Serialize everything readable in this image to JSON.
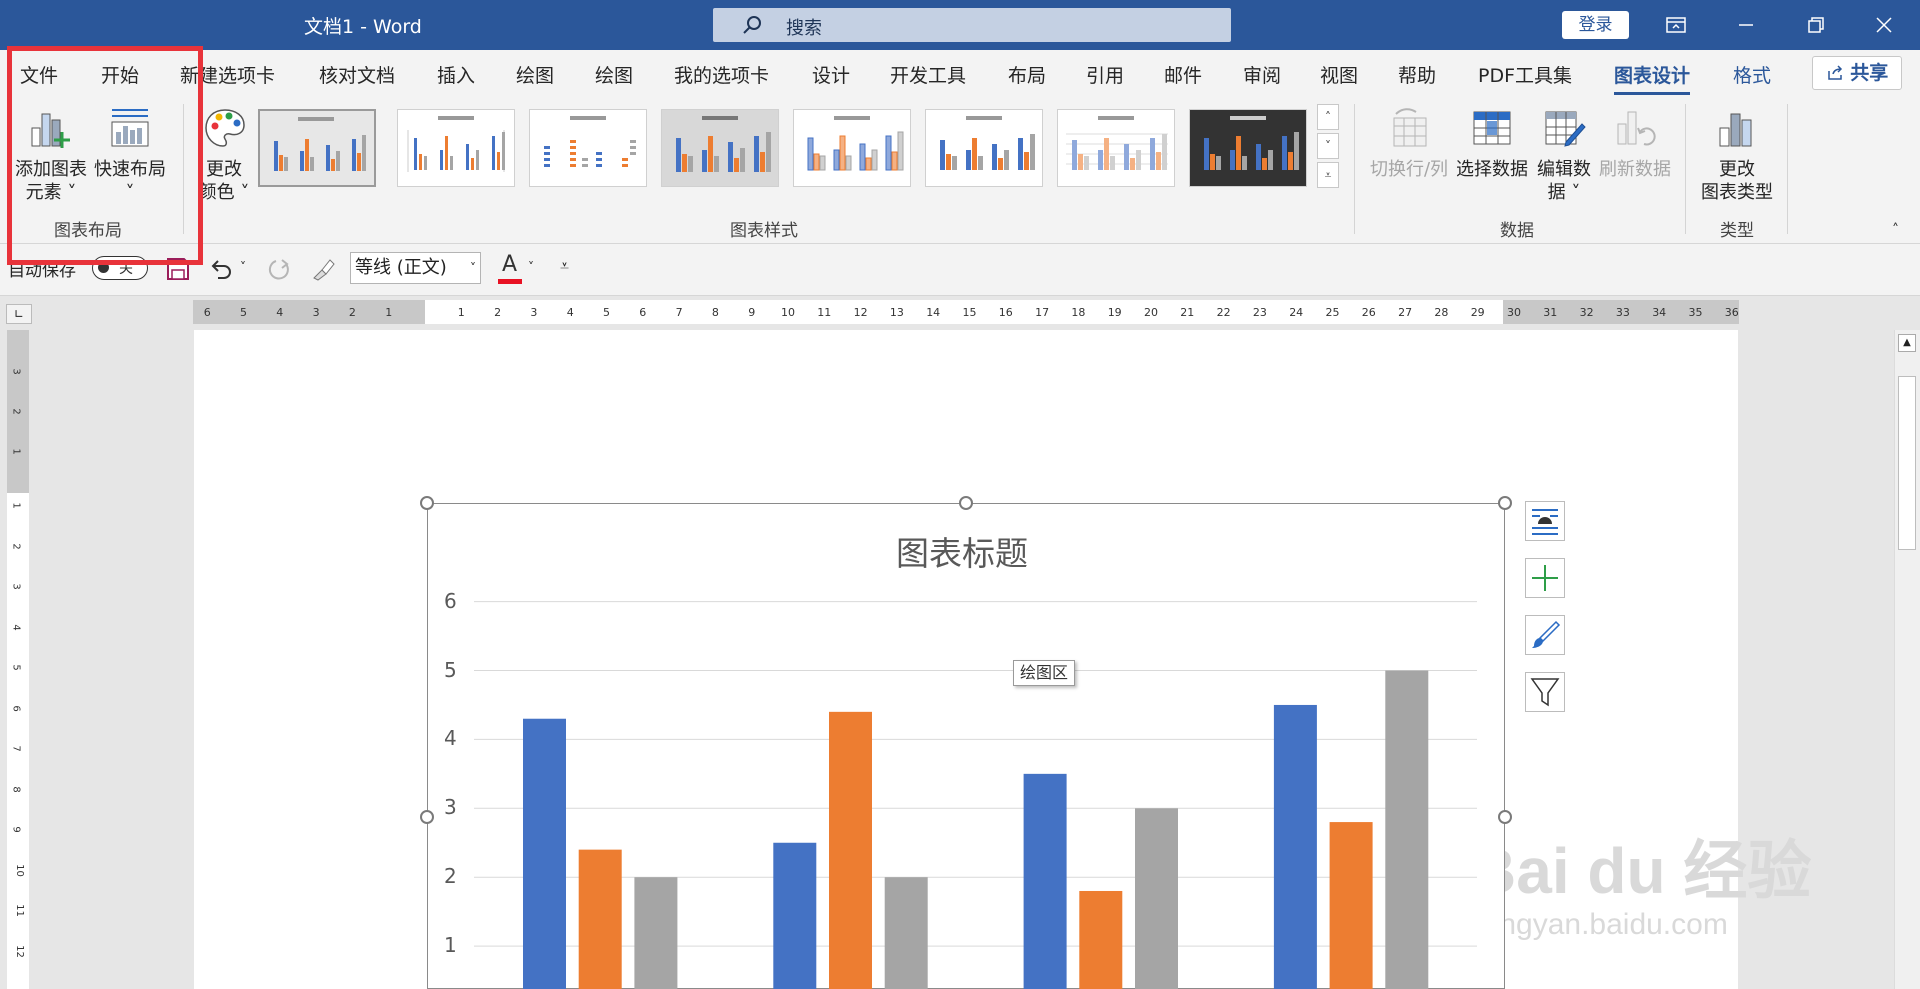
{
  "window": {
    "title": "文档1  -  Word",
    "search_placeholder": "搜索",
    "login_label": "登录",
    "controls": [
      "ribbon-display-icon",
      "minimize-icon",
      "restore-icon",
      "close-icon"
    ]
  },
  "tabs": [
    {
      "label": "文件",
      "active": false
    },
    {
      "label": "开始",
      "active": false
    },
    {
      "label": "新建选项卡",
      "active": false
    },
    {
      "label": "核对文档",
      "active": false
    },
    {
      "label": "插入",
      "active": false
    },
    {
      "label": "绘图",
      "active": false
    },
    {
      "label": "绘图",
      "active": false
    },
    {
      "label": "我的选项卡",
      "active": false
    },
    {
      "label": "设计",
      "active": false
    },
    {
      "label": "开发工具",
      "active": false
    },
    {
      "label": "布局",
      "active": false
    },
    {
      "label": "引用",
      "active": false
    },
    {
      "label": "邮件",
      "active": false
    },
    {
      "label": "审阅",
      "active": false
    },
    {
      "label": "视图",
      "active": false
    },
    {
      "label": "帮助",
      "active": false
    },
    {
      "label": "PDF工具集",
      "active": false
    },
    {
      "label": "图表设计",
      "active": true
    },
    {
      "label": "格式",
      "active": false
    }
  ],
  "share_label": "共享",
  "ribbon": {
    "add_element": {
      "line1": "添加图表",
      "line2": "元素"
    },
    "quick_layout": {
      "line1": "快速布局"
    },
    "change_color": {
      "line1": "更改",
      "line2": "颜色"
    },
    "group_layout": "图表布局",
    "group_styles": "图表样式",
    "switch_row_col": "切换行/列",
    "select_data": "选择数据",
    "edit_data": {
      "line1": "编辑数",
      "line2": "据"
    },
    "refresh_data": "刷新数据",
    "group_data": "数据",
    "change_type": {
      "line1": "更改",
      "line2": "图表类型"
    },
    "group_type": "类型"
  },
  "qat": {
    "autosave_label": "自动保存",
    "toggle_state": "关",
    "font_name": "等线 (正文)",
    "font_color_letter": "A"
  },
  "ruler": {
    "numbers_left": [
      "6",
      "5",
      "4",
      "3",
      "2",
      "1"
    ],
    "numbers_right": [
      "1",
      "2",
      "3",
      "4",
      "5",
      "6",
      "7",
      "8",
      "9",
      "10",
      "11",
      "12",
      "13",
      "14",
      "15",
      "16",
      "17",
      "18",
      "19",
      "20",
      "21",
      "22",
      "23",
      "24",
      "25",
      "26",
      "27",
      "28",
      "29",
      "30",
      "31",
      "32",
      "33",
      "34",
      "35",
      "36"
    ],
    "vertical_numbers": [
      "3",
      "2",
      "1",
      "1",
      "2",
      "3",
      "4",
      "5",
      "6",
      "7",
      "8",
      "9",
      "10",
      "11",
      "12"
    ]
  },
  "colors": {
    "series1": "#4472c4",
    "series2": "#ed7d31",
    "series3": "#a5a5a5",
    "accent": "#2b579a",
    "highlight": "#e8333a"
  },
  "chart_tooltip": "绘图区",
  "chart_data": {
    "type": "bar",
    "title": "图表标题",
    "categories": [
      "",
      "",
      "",
      ""
    ],
    "series": [
      {
        "values": [
          4.3,
          2.5,
          3.5,
          4.5
        ]
      },
      {
        "values": [
          2.4,
          4.4,
          1.8,
          2.8
        ]
      },
      {
        "values": [
          2.0,
          2.0,
          3.0,
          5.0
        ]
      }
    ],
    "yticks": [
      "1",
      "2",
      "3",
      "4",
      "5",
      "6"
    ],
    "ylim": [
      0,
      6
    ],
    "grid": true
  },
  "watermark": {
    "logo": "Bai du 经验",
    "sub": "jingyan.baidu.com"
  }
}
